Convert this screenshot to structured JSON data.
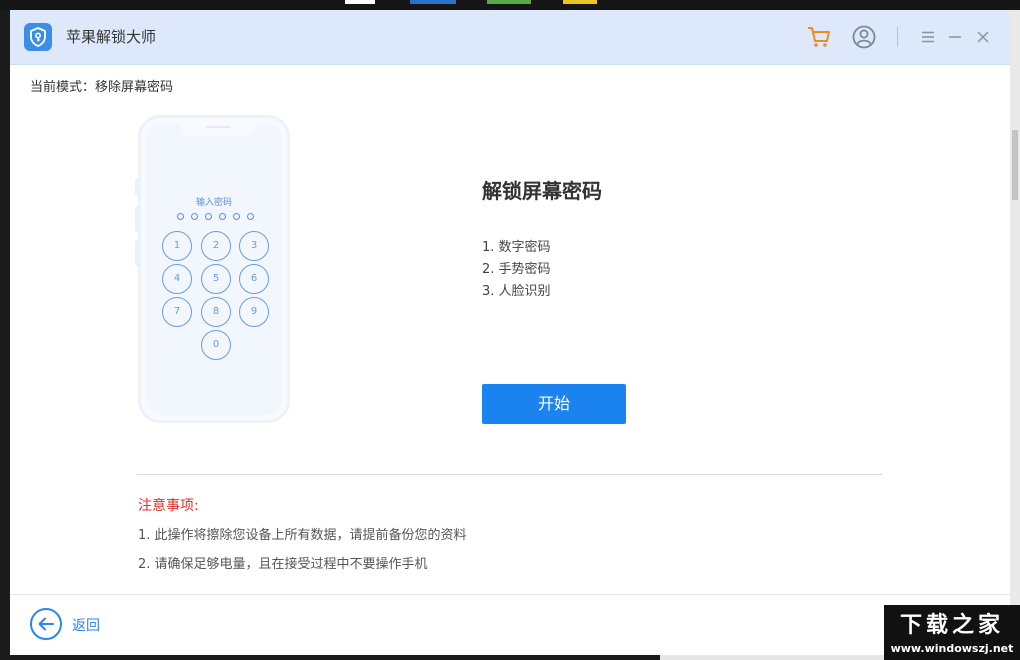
{
  "window": {
    "title": "苹果解锁大师"
  },
  "mode": {
    "text": "当前模式：移除屏幕密码"
  },
  "phone": {
    "passcode_label": "输入密码",
    "keys": [
      "1",
      "2",
      "3",
      "4",
      "5",
      "6",
      "7",
      "8",
      "9",
      "0"
    ]
  },
  "main": {
    "heading": "解锁屏幕密码",
    "features": [
      "1. 数字密码",
      "2. 手势密码",
      "3. 人脸识别"
    ],
    "start_label": "开始"
  },
  "notes": {
    "title": "注意事项:",
    "items": [
      "1. 此操作将擦除您设备上所有数据，请提前备份您的资料",
      "2. 请确保足够电量，且在接受过程中不要操作手机"
    ]
  },
  "footer": {
    "back_label": "返回"
  },
  "watermark": {
    "main": "下载之家",
    "sub": "www.windowszj.net"
  },
  "colors": {
    "accent": "#1a83f0",
    "titlebar": "#dde9fa",
    "cart": "#f08a24",
    "warning": "#e0302a"
  },
  "icons": [
    "shield-key-icon",
    "cart-icon",
    "user-icon",
    "menu-icon",
    "minimize-icon",
    "close-icon",
    "arrow-left-icon"
  ]
}
